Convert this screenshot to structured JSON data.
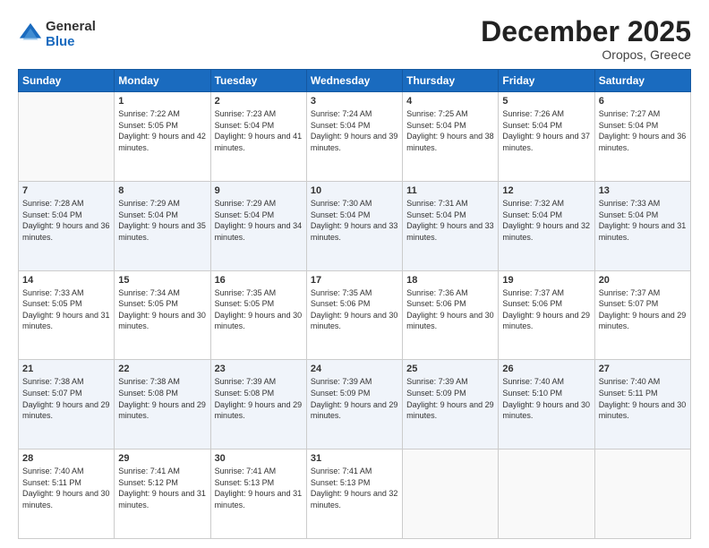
{
  "logo": {
    "general": "General",
    "blue": "Blue"
  },
  "header": {
    "month": "December 2025",
    "location": "Oropos, Greece"
  },
  "weekdays": [
    "Sunday",
    "Monday",
    "Tuesday",
    "Wednesday",
    "Thursday",
    "Friday",
    "Saturday"
  ],
  "weeks": [
    [
      {
        "day": "",
        "sunrise": "",
        "sunset": "",
        "daylight": ""
      },
      {
        "day": "1",
        "sunrise": "Sunrise: 7:22 AM",
        "sunset": "Sunset: 5:05 PM",
        "daylight": "Daylight: 9 hours and 42 minutes."
      },
      {
        "day": "2",
        "sunrise": "Sunrise: 7:23 AM",
        "sunset": "Sunset: 5:04 PM",
        "daylight": "Daylight: 9 hours and 41 minutes."
      },
      {
        "day": "3",
        "sunrise": "Sunrise: 7:24 AM",
        "sunset": "Sunset: 5:04 PM",
        "daylight": "Daylight: 9 hours and 39 minutes."
      },
      {
        "day": "4",
        "sunrise": "Sunrise: 7:25 AM",
        "sunset": "Sunset: 5:04 PM",
        "daylight": "Daylight: 9 hours and 38 minutes."
      },
      {
        "day": "5",
        "sunrise": "Sunrise: 7:26 AM",
        "sunset": "Sunset: 5:04 PM",
        "daylight": "Daylight: 9 hours and 37 minutes."
      },
      {
        "day": "6",
        "sunrise": "Sunrise: 7:27 AM",
        "sunset": "Sunset: 5:04 PM",
        "daylight": "Daylight: 9 hours and 36 minutes."
      }
    ],
    [
      {
        "day": "7",
        "sunrise": "Sunrise: 7:28 AM",
        "sunset": "Sunset: 5:04 PM",
        "daylight": "Daylight: 9 hours and 36 minutes."
      },
      {
        "day": "8",
        "sunrise": "Sunrise: 7:29 AM",
        "sunset": "Sunset: 5:04 PM",
        "daylight": "Daylight: 9 hours and 35 minutes."
      },
      {
        "day": "9",
        "sunrise": "Sunrise: 7:29 AM",
        "sunset": "Sunset: 5:04 PM",
        "daylight": "Daylight: 9 hours and 34 minutes."
      },
      {
        "day": "10",
        "sunrise": "Sunrise: 7:30 AM",
        "sunset": "Sunset: 5:04 PM",
        "daylight": "Daylight: 9 hours and 33 minutes."
      },
      {
        "day": "11",
        "sunrise": "Sunrise: 7:31 AM",
        "sunset": "Sunset: 5:04 PM",
        "daylight": "Daylight: 9 hours and 33 minutes."
      },
      {
        "day": "12",
        "sunrise": "Sunrise: 7:32 AM",
        "sunset": "Sunset: 5:04 PM",
        "daylight": "Daylight: 9 hours and 32 minutes."
      },
      {
        "day": "13",
        "sunrise": "Sunrise: 7:33 AM",
        "sunset": "Sunset: 5:04 PM",
        "daylight": "Daylight: 9 hours and 31 minutes."
      }
    ],
    [
      {
        "day": "14",
        "sunrise": "Sunrise: 7:33 AM",
        "sunset": "Sunset: 5:05 PM",
        "daylight": "Daylight: 9 hours and 31 minutes."
      },
      {
        "day": "15",
        "sunrise": "Sunrise: 7:34 AM",
        "sunset": "Sunset: 5:05 PM",
        "daylight": "Daylight: 9 hours and 30 minutes."
      },
      {
        "day": "16",
        "sunrise": "Sunrise: 7:35 AM",
        "sunset": "Sunset: 5:05 PM",
        "daylight": "Daylight: 9 hours and 30 minutes."
      },
      {
        "day": "17",
        "sunrise": "Sunrise: 7:35 AM",
        "sunset": "Sunset: 5:06 PM",
        "daylight": "Daylight: 9 hours and 30 minutes."
      },
      {
        "day": "18",
        "sunrise": "Sunrise: 7:36 AM",
        "sunset": "Sunset: 5:06 PM",
        "daylight": "Daylight: 9 hours and 30 minutes."
      },
      {
        "day": "19",
        "sunrise": "Sunrise: 7:37 AM",
        "sunset": "Sunset: 5:06 PM",
        "daylight": "Daylight: 9 hours and 29 minutes."
      },
      {
        "day": "20",
        "sunrise": "Sunrise: 7:37 AM",
        "sunset": "Sunset: 5:07 PM",
        "daylight": "Daylight: 9 hours and 29 minutes."
      }
    ],
    [
      {
        "day": "21",
        "sunrise": "Sunrise: 7:38 AM",
        "sunset": "Sunset: 5:07 PM",
        "daylight": "Daylight: 9 hours and 29 minutes."
      },
      {
        "day": "22",
        "sunrise": "Sunrise: 7:38 AM",
        "sunset": "Sunset: 5:08 PM",
        "daylight": "Daylight: 9 hours and 29 minutes."
      },
      {
        "day": "23",
        "sunrise": "Sunrise: 7:39 AM",
        "sunset": "Sunset: 5:08 PM",
        "daylight": "Daylight: 9 hours and 29 minutes."
      },
      {
        "day": "24",
        "sunrise": "Sunrise: 7:39 AM",
        "sunset": "Sunset: 5:09 PM",
        "daylight": "Daylight: 9 hours and 29 minutes."
      },
      {
        "day": "25",
        "sunrise": "Sunrise: 7:39 AM",
        "sunset": "Sunset: 5:09 PM",
        "daylight": "Daylight: 9 hours and 29 minutes."
      },
      {
        "day": "26",
        "sunrise": "Sunrise: 7:40 AM",
        "sunset": "Sunset: 5:10 PM",
        "daylight": "Daylight: 9 hours and 30 minutes."
      },
      {
        "day": "27",
        "sunrise": "Sunrise: 7:40 AM",
        "sunset": "Sunset: 5:11 PM",
        "daylight": "Daylight: 9 hours and 30 minutes."
      }
    ],
    [
      {
        "day": "28",
        "sunrise": "Sunrise: 7:40 AM",
        "sunset": "Sunset: 5:11 PM",
        "daylight": "Daylight: 9 hours and 30 minutes."
      },
      {
        "day": "29",
        "sunrise": "Sunrise: 7:41 AM",
        "sunset": "Sunset: 5:12 PM",
        "daylight": "Daylight: 9 hours and 31 minutes."
      },
      {
        "day": "30",
        "sunrise": "Sunrise: 7:41 AM",
        "sunset": "Sunset: 5:13 PM",
        "daylight": "Daylight: 9 hours and 31 minutes."
      },
      {
        "day": "31",
        "sunrise": "Sunrise: 7:41 AM",
        "sunset": "Sunset: 5:13 PM",
        "daylight": "Daylight: 9 hours and 32 minutes."
      },
      {
        "day": "",
        "sunrise": "",
        "sunset": "",
        "daylight": ""
      },
      {
        "day": "",
        "sunrise": "",
        "sunset": "",
        "daylight": ""
      },
      {
        "day": "",
        "sunrise": "",
        "sunset": "",
        "daylight": ""
      }
    ]
  ]
}
